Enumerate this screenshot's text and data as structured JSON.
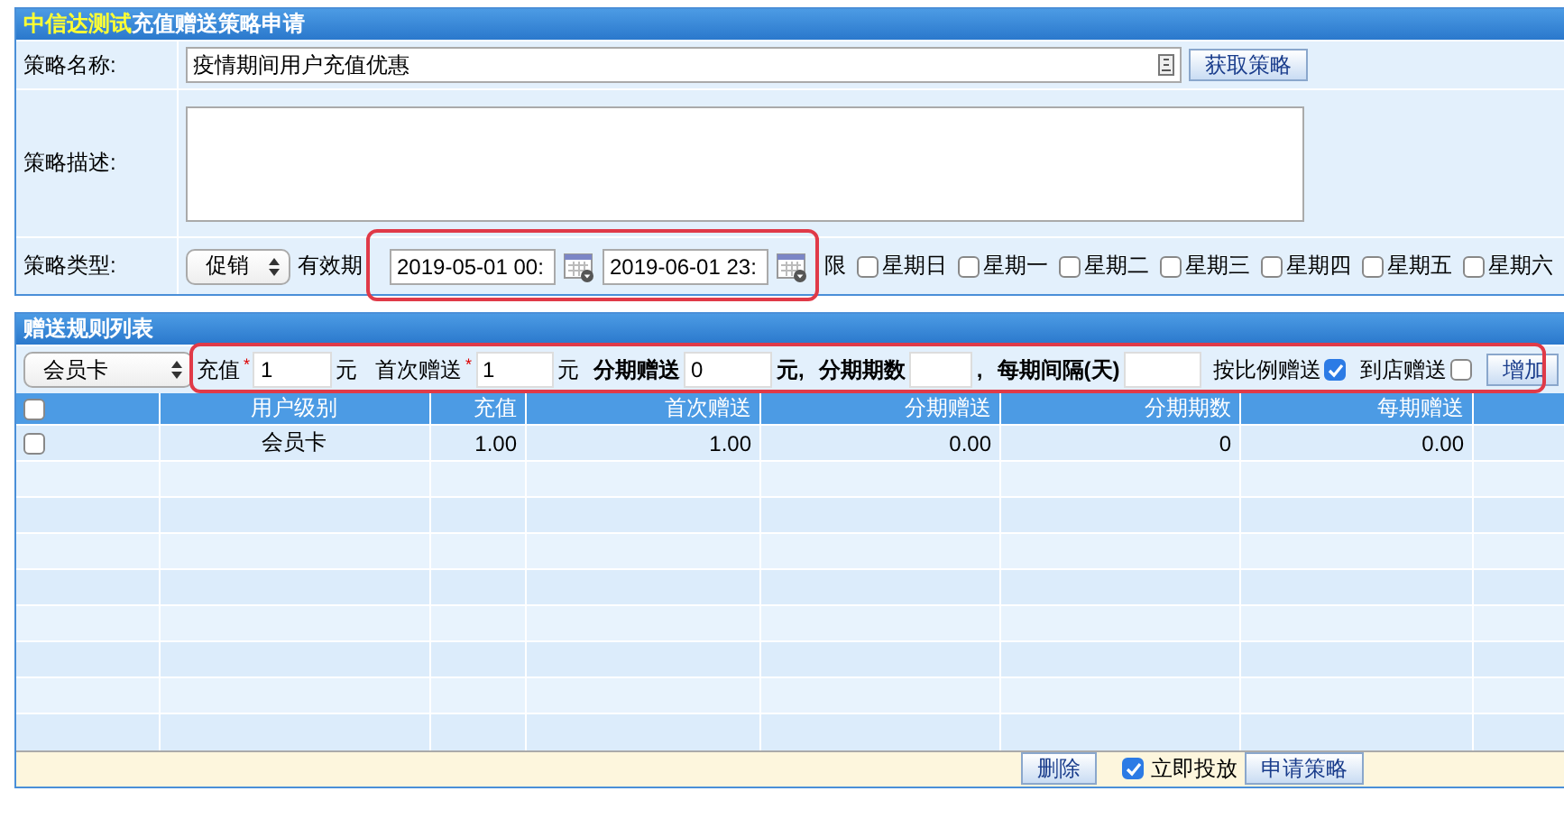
{
  "form": {
    "title_brand": "中信达测试",
    "title": "充值赠送策略申请",
    "name_label": "策略名称:",
    "name_value": "疫情期间用户充值优惠",
    "fetch_button": "获取策略",
    "description_label": "策略描述:",
    "type_label": "策略类型:",
    "type_value": "促销",
    "validity_label": "有效期",
    "start": "2019-05-01 00:",
    "end": "2019-06-01 23:",
    "validity_highlighted": true,
    "limit_label": "限",
    "weekdays": [
      {
        "label": "星期日",
        "checked": false
      },
      {
        "label": "星期一",
        "checked": false
      },
      {
        "label": "星期二",
        "checked": false
      },
      {
        "label": "星期三",
        "checked": false
      },
      {
        "label": "星期四",
        "checked": false
      },
      {
        "label": "星期五",
        "checked": false
      },
      {
        "label": "星期六",
        "checked": false
      }
    ]
  },
  "rules": {
    "title": "赠送规则列表",
    "level_value": "会员卡",
    "toolbar_highlighted": true,
    "fields": [
      {
        "label": "充值",
        "required_mark": "*",
        "value": "1",
        "unit": "元"
      },
      {
        "label": "首次赠送",
        "required_mark": "*",
        "value": "1",
        "unit": "元"
      },
      {
        "label": "分期赠送",
        "value": "0",
        "unit": "元,"
      },
      {
        "label": "分期期数",
        "unit": ","
      },
      {
        "label": "每期间隔(天)"
      }
    ],
    "proportional_label": "按比例赠送",
    "proportional": true,
    "instore_label": "到店赠送",
    "instore": false,
    "add_button": "增加",
    "header_checked": false,
    "columns": [
      "用户级别",
      "充值",
      "首次赠送",
      "分期赠送",
      "分期期数",
      "每期赠送"
    ],
    "rows": [
      {
        "checked": false,
        "cells": [
          "会员卡",
          "1.00",
          "1.00",
          "0.00",
          "0",
          "0.00"
        ]
      }
    ]
  },
  "footer": {
    "delete_button": "删除",
    "publish_label": "立即投放",
    "publish": true,
    "apply_button": "申请策略"
  }
}
